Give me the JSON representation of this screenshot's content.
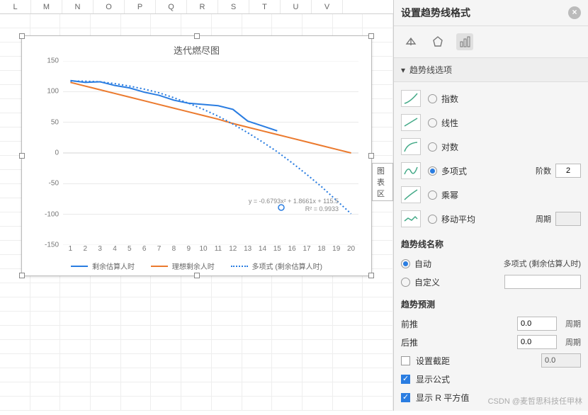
{
  "columns": [
    "L",
    "M",
    "N",
    "O",
    "P",
    "Q",
    "R",
    "S",
    "T",
    "U",
    "V"
  ],
  "chart_area_tooltip": "图表区",
  "panel": {
    "title": "设置趋势线格式",
    "section_title": "趋势线选项",
    "types": {
      "exponential": "指数",
      "linear": "线性",
      "logarithmic": "对数",
      "polynomial": "多项式",
      "power": "乘幂",
      "moving_average": "移动平均"
    },
    "selected_type": "polynomial",
    "order_label": "阶数",
    "order_value": "2",
    "period_label": "周期",
    "period_value": "",
    "name_header": "趋势线名称",
    "name_auto": "自动",
    "name_custom": "自定义",
    "auto_name_value": "多项式 (剩余估算人时)",
    "custom_name_value": "",
    "forecast_header": "趋势预测",
    "forward_label": "前推",
    "forward_value": "0.0",
    "backward_label": "后推",
    "backward_value": "0.0",
    "forecast_unit": "周期",
    "set_intercept_label": "设置截距",
    "set_intercept_value": "0.0",
    "show_equation_label": "显示公式",
    "show_rsq_label": "显示 R 平方值"
  },
  "watermark": "CSDN @麦哲思科技任甲林",
  "chart_data": {
    "type": "line",
    "title": "迭代燃尽图",
    "xlabel": "",
    "ylabel": "",
    "ylim": [
      -150,
      150
    ],
    "y_ticks": [
      150,
      100,
      50,
      0,
      -50,
      -100,
      -150
    ],
    "categories": [
      1,
      2,
      3,
      4,
      5,
      6,
      7,
      8,
      9,
      10,
      11,
      12,
      13,
      14,
      15,
      16,
      17,
      18,
      19,
      20
    ],
    "series": [
      {
        "name": "剩余估算人时",
        "color": "#2a7de1",
        "style": "solid",
        "values": [
          118,
          115,
          116,
          110,
          106,
          99,
          94,
          86,
          81,
          79,
          77,
          71,
          52,
          44,
          36,
          null,
          null,
          null,
          null,
          null
        ]
      },
      {
        "name": "理想剩余人时",
        "color": "#eb7a2e",
        "style": "solid",
        "values": [
          115,
          109,
          103,
          97,
          91,
          85,
          79,
          73,
          67,
          61,
          55,
          48,
          42,
          36,
          30,
          24,
          18,
          12,
          6,
          0
        ]
      },
      {
        "name": "多项式 (剩余估算人时)",
        "color": "#2a7de1",
        "style": "dotted",
        "values": [
          117,
          117,
          116,
          113,
          109,
          104,
          98,
          90,
          81,
          71,
          60,
          47,
          33,
          18,
          2,
          -16,
          -35,
          -55,
          -77,
          -99
        ]
      }
    ],
    "trendline": {
      "equation": "y = -0.6793x² + 1.8661x + 115.5",
      "r2": "R² = 0.9933"
    },
    "legend": [
      "剩余估算人时",
      "理想剩余人时",
      "多项式 (剩余估算人时)"
    ]
  }
}
